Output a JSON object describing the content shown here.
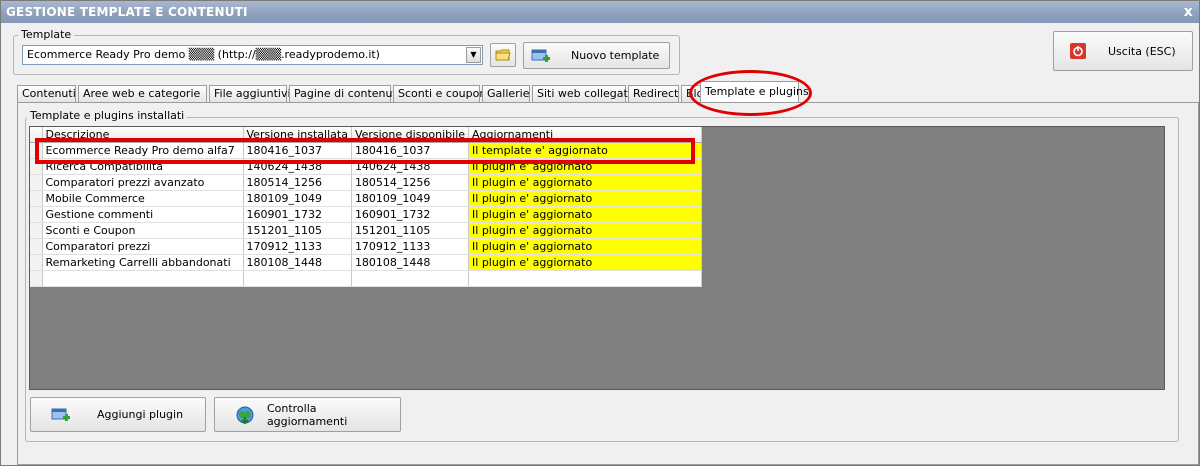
{
  "window": {
    "title": "GESTIONE TEMPLATE E CONTENUTI",
    "close_glyph": "x"
  },
  "template_group": {
    "title": "Template",
    "combo_value": "Ecommerce Ready Pro demo ▒▒▒ (http://▒▒▒.readyprodemo.it)",
    "new_template_label": "Nuovo template"
  },
  "exit_button": {
    "label": "Uscita (ESC)"
  },
  "tabs": [
    {
      "label": "Contenuti"
    },
    {
      "label": "Aree web e categorie"
    },
    {
      "label": "File aggiuntivi"
    },
    {
      "label": "Pagine di contenuti"
    },
    {
      "label": "Sconti e coupon"
    },
    {
      "label": "Gallerie"
    },
    {
      "label": "Siti web collegati"
    },
    {
      "label": "Redirect"
    },
    {
      "label": "Blog"
    },
    {
      "label": "Template e plugins",
      "active": true
    }
  ],
  "installed_group": {
    "title": "Template e plugins installati"
  },
  "grid": {
    "columns": [
      "Descrizione",
      "Versione installata",
      "Versione disponibile",
      "Aggiornamenti"
    ],
    "rows": [
      {
        "desc": "Ecommerce Ready Pro demo alfa7",
        "installed": "180416_1037",
        "available": "180416_1037",
        "status": "Il template e' aggiornato"
      },
      {
        "desc": "Ricerca Compatibilita",
        "installed": "140624_1438",
        "available": "140624_1438",
        "status": "Il plugin e' aggiornato"
      },
      {
        "desc": "Comparatori prezzi avanzato",
        "installed": "180514_1256",
        "available": "180514_1256",
        "status": "Il plugin e' aggiornato"
      },
      {
        "desc": "Mobile Commerce",
        "installed": "180109_1049",
        "available": "180109_1049",
        "status": "Il plugin e' aggiornato"
      },
      {
        "desc": "Gestione commenti",
        "installed": "160901_1732",
        "available": "160901_1732",
        "status": "Il plugin e' aggiornato"
      },
      {
        "desc": "Sconti e Coupon",
        "installed": "151201_1105",
        "available": "151201_1105",
        "status": "Il plugin e' aggiornato"
      },
      {
        "desc": "Comparatori prezzi",
        "installed": "170912_1133",
        "available": "170912_1133",
        "status": "Il plugin e' aggiornato"
      },
      {
        "desc": "Remarketing Carrelli abbandonati",
        "installed": "180108_1448",
        "available": "180108_1448",
        "status": "Il plugin e' aggiornato"
      }
    ]
  },
  "bottom_buttons": {
    "add_plugin": "Aggiungi plugin",
    "check_updates": "Controlla aggiornamenti"
  },
  "colors": {
    "status_fill": "#ffff00",
    "annotation": "#e00000",
    "grid_background": "#808080"
  },
  "icons": [
    "folder-icon",
    "add-template-icon",
    "exit-power-icon",
    "add-plugin-icon",
    "check-updates-globe-icon"
  ]
}
